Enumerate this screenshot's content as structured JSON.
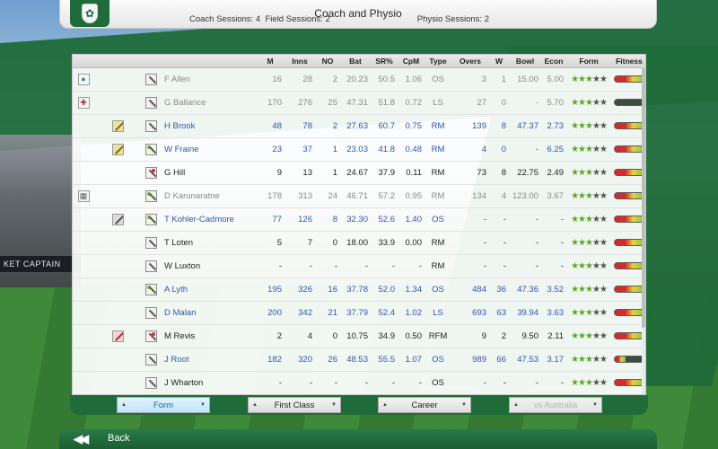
{
  "header": {
    "title": "Coach and Physio",
    "coach_sessions": "Coach Sessions: 4",
    "field_sessions": "Field Sessions: 2",
    "physio_sessions": "Physio Sessions: 2"
  },
  "columns": [
    "M",
    "Inns",
    "NO",
    "Bat",
    "SR%",
    "CpM",
    "Type",
    "Overs",
    "W",
    "Bowl",
    "Econ",
    "Form",
    "Fitness"
  ],
  "players": [
    {
      "name": "F Allen",
      "style": "dim",
      "status_icon": "globe-icon",
      "session_icon": "",
      "role": "bat-icon",
      "M": "16",
      "Inns": "28",
      "NO": "2",
      "Bat": "20.23",
      "SR": "50.5",
      "CpM": "1.06",
      "Type": "OS",
      "Overs": "3",
      "W": "1",
      "Bowl": "15.00",
      "Econ": "5.00",
      "form": 3,
      "fitness": 0.85
    },
    {
      "name": "G Ballance",
      "style": "dim",
      "status_icon": "injury-cross-icon",
      "session_icon": "",
      "role": "bat-icon",
      "M": "170",
      "Inns": "276",
      "NO": "25",
      "Bat": "47.31",
      "SR": "51.8",
      "CpM": "0.72",
      "Type": "LS",
      "Overs": "27",
      "W": "0",
      "Bowl": "-",
      "Econ": "5.70",
      "form": 3,
      "fitness": 0.0
    },
    {
      "name": "H Brook",
      "style": "blue",
      "status_icon": "",
      "session_icon": "bat-session-icon",
      "role": "bat-icon",
      "M": "48",
      "Inns": "78",
      "NO": "2",
      "Bat": "27.63",
      "SR": "60.7",
      "CpM": "0.75",
      "Type": "RM",
      "Overs": "139",
      "W": "8",
      "Bowl": "47.37",
      "Econ": "2.73",
      "form": 3,
      "fitness": 0.85
    },
    {
      "name": "W Fraine",
      "style": "blue",
      "status_icon": "",
      "session_icon": "bat-session-icon",
      "role": "keeper-icon",
      "M": "23",
      "Inns": "37",
      "NO": "1",
      "Bat": "23.03",
      "SR": "41.8",
      "CpM": "0.48",
      "Type": "RM",
      "Overs": "4",
      "W": "0",
      "Bowl": "-",
      "Econ": "6.25",
      "form": 3,
      "fitness": 0.85
    },
    {
      "name": "G Hill",
      "style": "black",
      "status_icon": "",
      "session_icon": "",
      "role": "allrounder-icon",
      "M": "9",
      "Inns": "13",
      "NO": "1",
      "Bat": "24.67",
      "SR": "37.9",
      "CpM": "0.11",
      "Type": "RM",
      "Overs": "73",
      "W": "8",
      "Bowl": "22.75",
      "Econ": "2.49",
      "form": 3,
      "fitness": 0.85
    },
    {
      "name": "D Karunaratne",
      "style": "dim",
      "status_icon": "international-duty-icon",
      "session_icon": "",
      "role": "keeper-icon",
      "M": "178",
      "Inns": "313",
      "NO": "24",
      "Bat": "46.71",
      "SR": "57.2",
      "CpM": "0.95",
      "Type": "RM",
      "Overs": "134",
      "W": "4",
      "Bowl": "123.00",
      "Econ": "3.67",
      "form": 3,
      "fitness": 0.85
    },
    {
      "name": "T Kohler-Cadmore",
      "style": "blue",
      "status_icon": "",
      "session_icon": "field-session-icon",
      "role": "keeper-icon",
      "M": "77",
      "Inns": "126",
      "NO": "8",
      "Bat": "32.30",
      "SR": "52.6",
      "CpM": "1.40",
      "Type": "OS",
      "Overs": "-",
      "W": "-",
      "Bowl": "-",
      "Econ": "-",
      "form": 3,
      "fitness": 0.85
    },
    {
      "name": "T Loten",
      "style": "black",
      "status_icon": "",
      "session_icon": "",
      "role": "bat-icon",
      "M": "5",
      "Inns": "7",
      "NO": "0",
      "Bat": "18.00",
      "SR": "33.9",
      "CpM": "0.00",
      "Type": "RM",
      "Overs": "-",
      "W": "-",
      "Bowl": "-",
      "Econ": "-",
      "form": 3,
      "fitness": 0.85
    },
    {
      "name": "W Luxton",
      "style": "black",
      "status_icon": "",
      "session_icon": "",
      "role": "bat-icon",
      "M": "-",
      "Inns": "-",
      "NO": "-",
      "Bat": "-",
      "SR": "-",
      "CpM": "-",
      "Type": "RM",
      "Overs": "-",
      "W": "-",
      "Bowl": "-",
      "Econ": "-",
      "form": 3,
      "fitness": 0.85
    },
    {
      "name": "A Lyth",
      "style": "blue",
      "status_icon": "",
      "session_icon": "",
      "role": "keeper-icon",
      "M": "195",
      "Inns": "326",
      "NO": "16",
      "Bat": "37.78",
      "SR": "52.0",
      "CpM": "1.34",
      "Type": "OS",
      "Overs": "484",
      "W": "36",
      "Bowl": "47.36",
      "Econ": "3.52",
      "form": 3,
      "fitness": 0.85
    },
    {
      "name": "D Malan",
      "style": "blue",
      "status_icon": "",
      "session_icon": "",
      "role": "bat-icon",
      "M": "200",
      "Inns": "342",
      "NO": "21",
      "Bat": "37.79",
      "SR": "52.4",
      "CpM": "1.02",
      "Type": "LS",
      "Overs": "693",
      "W": "63",
      "Bowl": "39.94",
      "Econ": "3.63",
      "form": 3,
      "fitness": 0.85
    },
    {
      "name": "M Revis",
      "style": "black",
      "status_icon": "",
      "session_icon": "physio-session-icon",
      "role": "allrounder-icon",
      "M": "2",
      "Inns": "4",
      "NO": "0",
      "Bat": "10.75",
      "SR": "34.9",
      "CpM": "0.50",
      "Type": "RFM",
      "Overs": "9",
      "W": "2",
      "Bowl": "9.50",
      "Econ": "2.11",
      "form": 3,
      "fitness": 0.85
    },
    {
      "name": "J Root",
      "style": "blue",
      "status_icon": "",
      "session_icon": "",
      "role": "bat-icon",
      "M": "182",
      "Inns": "320",
      "NO": "26",
      "Bat": "48.53",
      "SR": "55.5",
      "CpM": "1.07",
      "Type": "OS",
      "Overs": "989",
      "W": "66",
      "Bowl": "47.53",
      "Econ": "3.17",
      "form": 3,
      "fitness": 0.3
    },
    {
      "name": "J Wharton",
      "style": "black",
      "status_icon": "",
      "session_icon": "",
      "role": "bat-icon",
      "M": "-",
      "Inns": "-",
      "NO": "-",
      "Bat": "-",
      "SR": "-",
      "CpM": "-",
      "Type": "OS",
      "Overs": "-",
      "W": "-",
      "Bowl": "-",
      "Econ": "-",
      "form": 3,
      "fitness": 0.85
    }
  ],
  "filters": {
    "view": "Form",
    "competition": "First Class",
    "period": "Career",
    "opponent": "vs Australia"
  },
  "footer": {
    "back_label": "Back"
  },
  "background": {
    "board_text": "KET CAPTAIN"
  },
  "colors": {
    "brand_green": "#1f6b3a",
    "link_blue": "#2f56b3",
    "star_green": "#58a823"
  }
}
